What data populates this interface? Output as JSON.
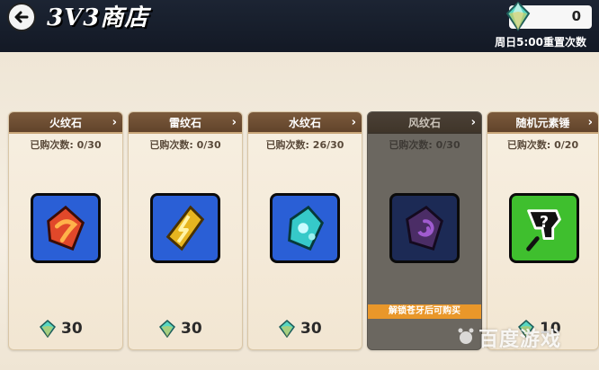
{
  "header": {
    "title": "3V3商店",
    "currency_amount": "0",
    "reset_note": "周日5:00重置次数"
  },
  "shop": {
    "items": [
      {
        "name": "火纹石",
        "bought": "已购次数: 0/30",
        "price": "30",
        "icon": "fire-stone-icon",
        "bg": "#2a5fd6",
        "gem": "#e1482a",
        "locked": false
      },
      {
        "name": "雷纹石",
        "bought": "已购次数: 0/30",
        "price": "30",
        "icon": "thunder-stone-icon",
        "bg": "#2a5fd6",
        "gem": "#e6b520",
        "locked": false
      },
      {
        "name": "水纹石",
        "bought": "已购次数: 26/30",
        "price": "30",
        "icon": "water-stone-icon",
        "bg": "#2a5fd6",
        "gem": "#36c9c9",
        "locked": false
      },
      {
        "name": "风纹石",
        "bought": "已购次数: 0/30",
        "price": "",
        "icon": "wind-stone-icon",
        "bg": "#1c2a55",
        "gem": "#7b3ca6",
        "locked": true,
        "lock_text": "解锁苍牙后可购买"
      },
      {
        "name": "随机元素锤",
        "bought": "已购次数: 0/20",
        "price": "10",
        "icon": "random-hammer-icon",
        "bg": "#3fbf2e",
        "gem": "#111111",
        "locked": false
      }
    ]
  },
  "watermark": "百度游戏"
}
